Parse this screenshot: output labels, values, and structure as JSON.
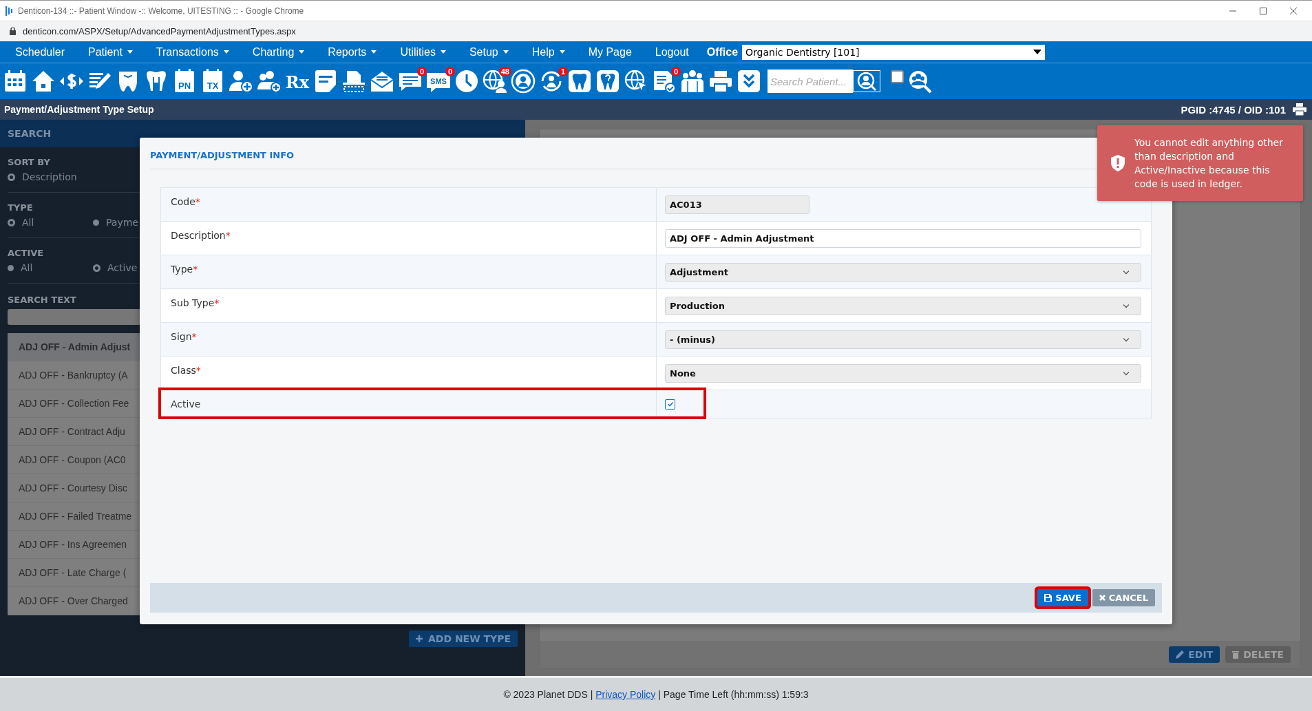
{
  "browser": {
    "title": "Denticon-134 ::- Patient Window -:: Welcome, UITESTING :: - Google Chrome",
    "url": "denticon.com/ASPX/Setup/AdvancedPaymentAdjustmentTypes.aspx"
  },
  "menu": {
    "items": [
      {
        "label": "Scheduler",
        "has_menu": false
      },
      {
        "label": "Patient",
        "has_menu": true
      },
      {
        "label": "Transactions",
        "has_menu": true
      },
      {
        "label": "Charting",
        "has_menu": true
      },
      {
        "label": "Reports",
        "has_menu": true
      },
      {
        "label": "Utilities",
        "has_menu": true
      },
      {
        "label": "Setup",
        "has_menu": true
      },
      {
        "label": "Help",
        "has_menu": true
      },
      {
        "label": "My Page",
        "has_menu": false
      },
      {
        "label": "Logout",
        "has_menu": false
      }
    ],
    "office_label": "Office",
    "office_value": "Organic Dentistry [101]"
  },
  "toolbar": {
    "icon_texts": [
      "PN",
      "TX",
      "Rx",
      "SMS"
    ],
    "badges": [
      "0",
      "0",
      "48",
      "1",
      "0"
    ],
    "search": {
      "placeholder": "Search Patient..."
    },
    "checkbox": {
      "checked": false
    }
  },
  "page_header": {
    "title": "Payment/Adjustment Type Setup",
    "ids": "PGID :4745  /  OID :101"
  },
  "search_panel": {
    "header": "SEARCH",
    "groups": [
      {
        "title": "SORT BY",
        "options": [
          {
            "label": "Description",
            "selected": true
          }
        ]
      },
      {
        "title": "TYPE",
        "options": [
          {
            "label": "All",
            "selected": true
          },
          {
            "label": "Payme",
            "selected": false
          }
        ]
      },
      {
        "title": "ACTIVE",
        "options": [
          {
            "label": "All",
            "selected": false
          },
          {
            "label": "Active",
            "selected": true
          }
        ]
      }
    ],
    "search_text_title": "SEARCH TEXT",
    "results": [
      {
        "label": "ADJ OFF - Admin Adjust",
        "selected": true
      },
      {
        "label": "ADJ OFF - Bankruptcy (A",
        "selected": false
      },
      {
        "label": "ADJ OFF - Collection Fee",
        "selected": false
      },
      {
        "label": "ADJ OFF - Contract Adju",
        "selected": false
      },
      {
        "label": "ADJ OFF - Coupon (AC0",
        "selected": false
      },
      {
        "label": "ADJ OFF - Courtesy Disc",
        "selected": false
      },
      {
        "label": "ADJ OFF - Failed Treatme",
        "selected": false
      },
      {
        "label": "ADJ OFF - Ins Agreemen",
        "selected": false
      },
      {
        "label": "ADJ OFF - Late Charge (",
        "selected": false
      },
      {
        "label": "ADJ OFF - Over Charged",
        "selected": false
      }
    ],
    "add_button": "ADD NEW TYPE"
  },
  "detail_panel": {
    "buttons": [
      {
        "label": "EDIT",
        "kind": "primary"
      },
      {
        "label": "DELETE",
        "kind": "disabled"
      }
    ]
  },
  "modal": {
    "title": "PAYMENT/ADJUSTMENT INFO",
    "fields": [
      {
        "label": "Code",
        "required_mark": "*",
        "kind": "readonly",
        "value": "AC013",
        "highlighted": false
      },
      {
        "label": "Description",
        "required_mark": "*",
        "kind": "text",
        "value": "ADJ OFF - Admin Adjustment",
        "highlighted": false
      },
      {
        "label": "Type",
        "required_mark": "*",
        "kind": "select",
        "value": "Adjustment",
        "highlighted": false
      },
      {
        "label": "Sub Type",
        "required_mark": "*",
        "kind": "select",
        "value": "Production",
        "highlighted": false
      },
      {
        "label": "Sign",
        "required_mark": "*",
        "kind": "select",
        "value": "- (minus)",
        "highlighted": false
      },
      {
        "label": "Class",
        "required_mark": "*",
        "kind": "select",
        "value": "None",
        "highlighted": false
      },
      {
        "label": "Active",
        "kind": "checkbox",
        "checked": true,
        "highlighted": true
      }
    ],
    "buttons": [
      {
        "label": "SAVE",
        "kind": "save",
        "highlighted": true
      },
      {
        "label": "CANCEL",
        "kind": "cancel",
        "highlighted": false
      }
    ]
  },
  "toast": {
    "message": "You cannot edit anything other than description and Active/Inactive because this code is used in ledger."
  },
  "footer": {
    "copyright": "© 2023 Planet DDS | ",
    "link": "Privacy Policy",
    "rest": " |  Page Time Left (hh:mm:ss) 1:59:3"
  }
}
